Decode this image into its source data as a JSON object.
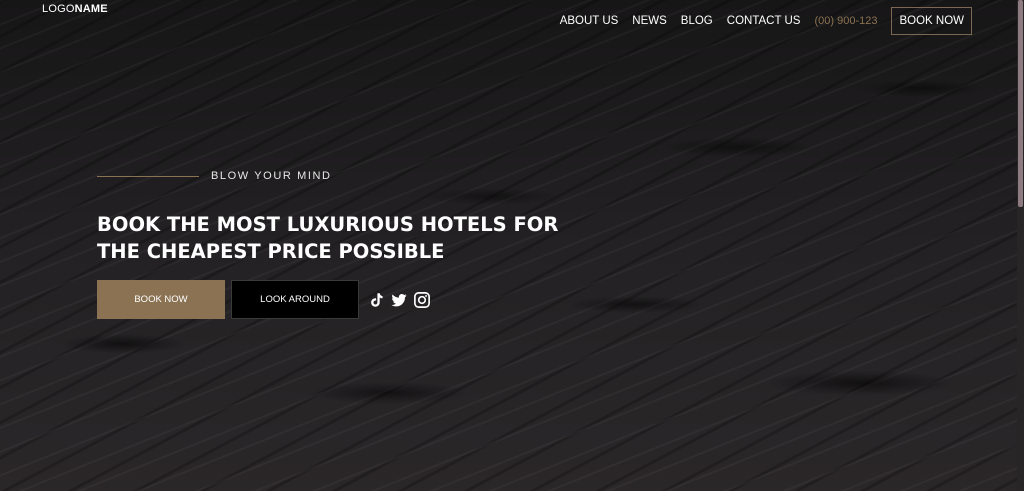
{
  "logo": {
    "light": "LOGO",
    "bold": "NAME"
  },
  "nav": {
    "items": [
      "ABOUT US",
      "NEWS",
      "BLOG",
      "CONTACT US"
    ],
    "phone": "(00) 900-123",
    "book_label": "BOOK NOW"
  },
  "hero": {
    "eyebrow": "BLOW YOUR MIND",
    "headline_line1": "BOOK THE MOST LUXURIOUS HOTELS FOR",
    "headline_line2": "THE CHEAPEST PRICE POSSIBLE",
    "primary_cta": "BOOK NOW",
    "secondary_cta": "LOOK AROUND"
  },
  "social": {
    "icons": [
      "tiktok-icon",
      "twitter-icon",
      "instagram-icon"
    ]
  },
  "colors": {
    "accent": "#8a7252",
    "background": "#1e1d1e",
    "secondary_button": "#000000",
    "scrollbar_thumb": "#8e7b82"
  }
}
